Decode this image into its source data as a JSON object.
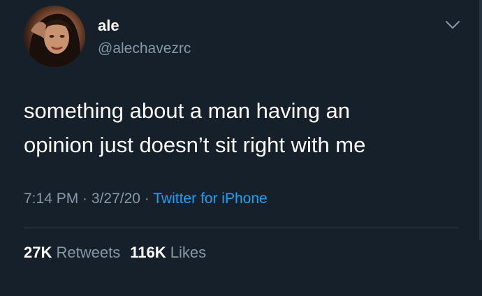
{
  "user": {
    "display_name": "ale",
    "handle": "@alechavezrc"
  },
  "tweet": {
    "line1": "something about a man having an",
    "line2": "opinion just doesn’t sit right with me"
  },
  "meta": {
    "time": "7:14 PM",
    "separator1": " · ",
    "date": "3/27/20",
    "separator2": " · ",
    "source": "Twitter for iPhone"
  },
  "stats": {
    "retweets_count": "27K",
    "retweets_label": "Retweets",
    "likes_count": "116K",
    "likes_label": "Likes"
  },
  "icons": {
    "menu": "chevron-down-icon"
  },
  "colors": {
    "background": "#15202b",
    "secondary_text": "#8899a6",
    "link": "#1da1f2",
    "divider": "#38444d"
  }
}
